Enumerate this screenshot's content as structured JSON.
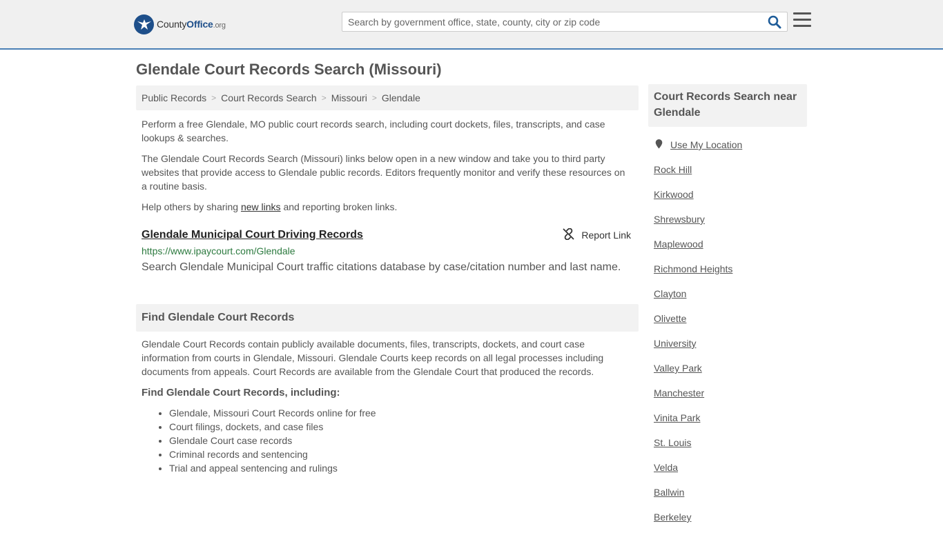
{
  "header": {
    "logo": {
      "county": "County",
      "office": "Office",
      "org": ".org"
    },
    "search_placeholder": "Search by government office, state, county, city or zip code"
  },
  "page": {
    "title": "Glendale Court Records Search (Missouri)"
  },
  "breadcrumb": [
    "Public Records",
    "Court Records Search",
    "Missouri",
    "Glendale"
  ],
  "intro": {
    "p1": "Perform a free Glendale, MO public court records search, including court dockets, files, transcripts, and case lookups & searches.",
    "p2": "The Glendale Court Records Search (Missouri) links below open in a new window and take you to third party websites that provide access to Glendale public records. Editors frequently monitor and verify these resources on a routine basis.",
    "p3_before": "Help others by sharing ",
    "p3_link": "new links",
    "p3_after": " and reporting broken links."
  },
  "result": {
    "title": "Glendale Municipal Court Driving Records",
    "report_label": "Report Link",
    "url": "https://www.ipaycourt.com/Glendale",
    "description": "Search Glendale Municipal Court traffic citations database by case/citation number and last name."
  },
  "find_section": {
    "heading": "Find Glendale Court Records",
    "body": "Glendale Court Records contain publicly available documents, files, transcripts, dockets, and court case information from courts in Glendale, Missouri. Glendale Courts keep records on all legal processes including documents from appeals. Court Records are available from the Glendale Court that produced the records.",
    "subheading": "Find Glendale Court Records, including:",
    "items": [
      "Glendale, Missouri Court Records online for free",
      "Court filings, dockets, and case files",
      "Glendale Court case records",
      "Criminal records and sentencing",
      "Trial and appeal sentencing and rulings"
    ]
  },
  "sidebar": {
    "heading": "Court Records Search near Glendale",
    "use_location": "Use My Location",
    "links": [
      "Rock Hill",
      "Kirkwood",
      "Shrewsbury",
      "Maplewood",
      "Richmond Heights",
      "Clayton",
      "Olivette",
      "University",
      "Valley Park",
      "Manchester",
      "Vinita Park",
      "St. Louis",
      "Velda",
      "Ballwin",
      "Berkeley"
    ]
  },
  "colors": {
    "header_bg": "#f0f0f0",
    "header_border": "#4a7fb5",
    "brand_blue": "#1e4f8a",
    "url_green": "#2c7a3f",
    "panel_bg": "#f2f2f2"
  },
  "icons": [
    "logo-eagle-icon",
    "search-icon",
    "hamburger-menu-icon",
    "broken-link-icon",
    "location-pin-icon"
  ]
}
